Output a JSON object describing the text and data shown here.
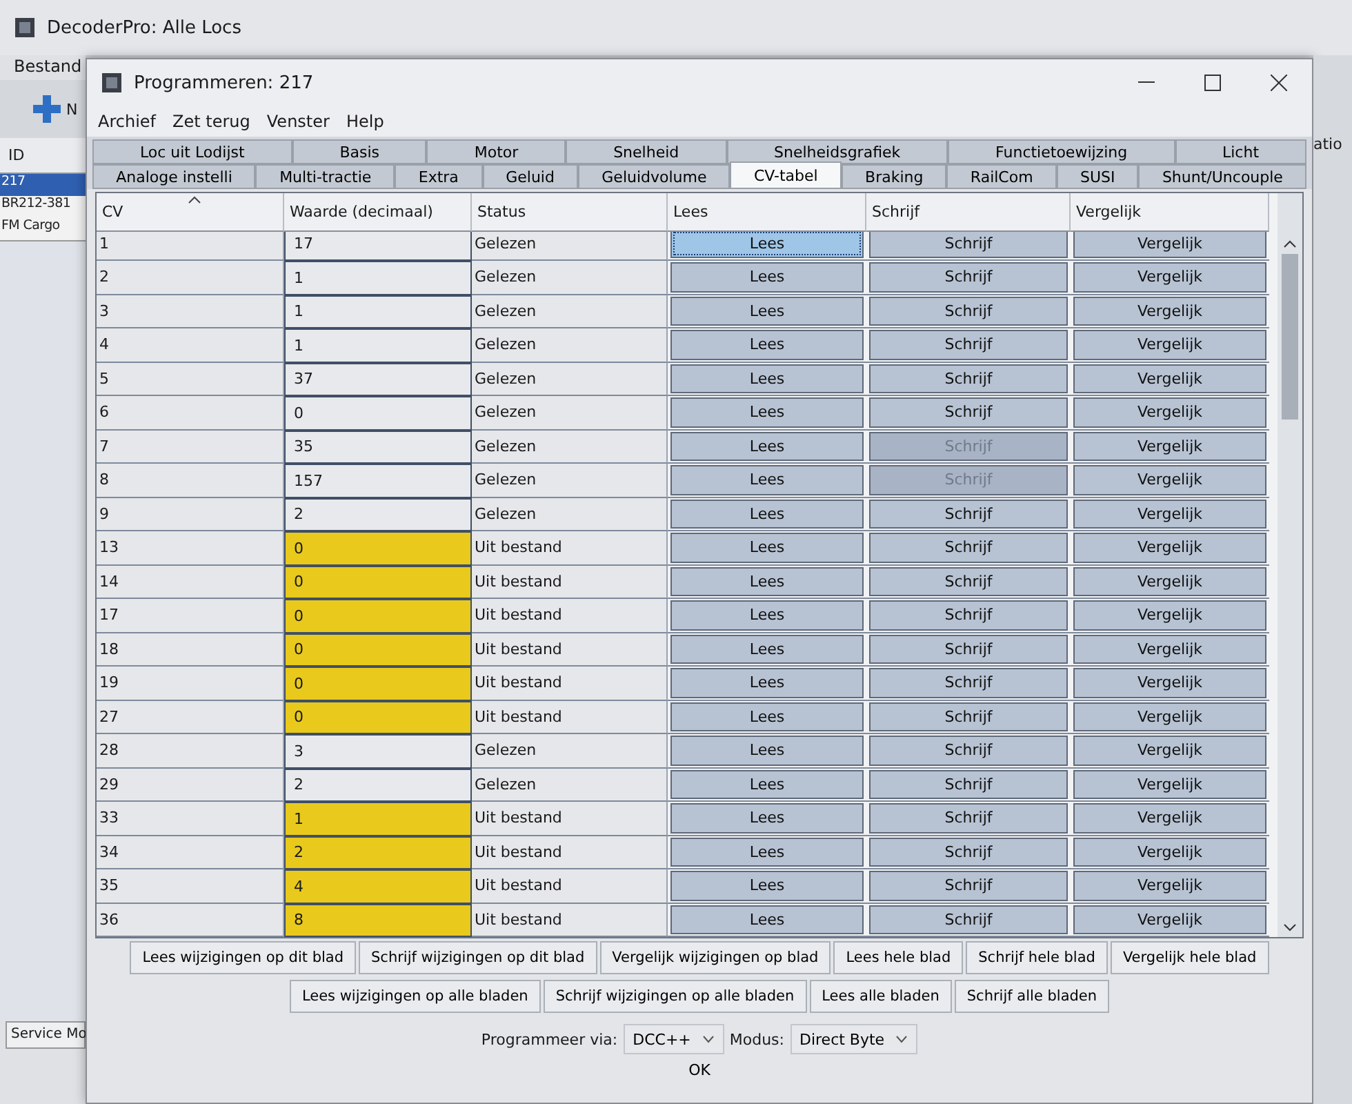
{
  "main_window": {
    "title": "DecoderPro: Alle Locs",
    "menu": [
      "Bestand"
    ],
    "toolbar_label": "N",
    "list_header": "ID",
    "locs": [
      {
        "label": "217",
        "selected": true
      },
      {
        "label": "BR212-381",
        "selected": false
      },
      {
        "label": "FM Cargo",
        "selected": false
      }
    ],
    "status_tab": "Service Mo",
    "right_edge_text": "atio"
  },
  "dialog": {
    "title": "Programmeren: 217",
    "menu": [
      "Archief",
      "Zet terug",
      "Venster",
      "Help"
    ],
    "tab_rows": [
      [
        {
          "label": "Loc uit Lodijst",
          "selected": false
        },
        {
          "label": "Basis",
          "selected": false
        },
        {
          "label": "Motor",
          "selected": false
        },
        {
          "label": "Snelheid",
          "selected": false
        },
        {
          "label": "Snelheidsgrafiek",
          "selected": false
        },
        {
          "label": "Functietoewijzing",
          "selected": false
        },
        {
          "label": "Licht",
          "selected": false
        }
      ],
      [
        {
          "label": "Analoge instelli",
          "selected": false
        },
        {
          "label": "Multi-tractie",
          "selected": false
        },
        {
          "label": "Extra",
          "selected": false
        },
        {
          "label": "Geluid",
          "selected": false
        },
        {
          "label": "Geluidvolume",
          "selected": false
        },
        {
          "label": "CV-tabel",
          "selected": true
        },
        {
          "label": "Braking",
          "selected": false
        },
        {
          "label": "RailCom",
          "selected": false
        },
        {
          "label": "SUSI",
          "selected": false
        },
        {
          "label": "Shunt/Uncouple",
          "selected": false
        }
      ]
    ],
    "table": {
      "columns": [
        "CV",
        "Waarde (decimaal)",
        "Status",
        "Lees",
        "Schrijf",
        "Vergelijk"
      ],
      "rows": [
        {
          "cv": "1",
          "value": "17",
          "status": "Gelezen",
          "from_file": false,
          "read": "Lees",
          "read_focused": true,
          "write": "Schrijf",
          "write_disabled": false,
          "compare": "Vergelijk"
        },
        {
          "cv": "2",
          "value": "1",
          "status": "Gelezen",
          "from_file": false,
          "read": "Lees",
          "read_focused": false,
          "write": "Schrijf",
          "write_disabled": false,
          "compare": "Vergelijk"
        },
        {
          "cv": "3",
          "value": "1",
          "status": "Gelezen",
          "from_file": false,
          "read": "Lees",
          "read_focused": false,
          "write": "Schrijf",
          "write_disabled": false,
          "compare": "Vergelijk"
        },
        {
          "cv": "4",
          "value": "1",
          "status": "Gelezen",
          "from_file": false,
          "read": "Lees",
          "read_focused": false,
          "write": "Schrijf",
          "write_disabled": false,
          "compare": "Vergelijk"
        },
        {
          "cv": "5",
          "value": "37",
          "status": "Gelezen",
          "from_file": false,
          "read": "Lees",
          "read_focused": false,
          "write": "Schrijf",
          "write_disabled": false,
          "compare": "Vergelijk"
        },
        {
          "cv": "6",
          "value": "0",
          "status": "Gelezen",
          "from_file": false,
          "read": "Lees",
          "read_focused": false,
          "write": "Schrijf",
          "write_disabled": false,
          "compare": "Vergelijk"
        },
        {
          "cv": "7",
          "value": "35",
          "status": "Gelezen",
          "from_file": false,
          "read": "Lees",
          "read_focused": false,
          "write": "Schrijf",
          "write_disabled": true,
          "compare": "Vergelijk"
        },
        {
          "cv": "8",
          "value": "157",
          "status": "Gelezen",
          "from_file": false,
          "read": "Lees",
          "read_focused": false,
          "write": "Schrijf",
          "write_disabled": true,
          "compare": "Vergelijk"
        },
        {
          "cv": "9",
          "value": "2",
          "status": "Gelezen",
          "from_file": false,
          "read": "Lees",
          "read_focused": false,
          "write": "Schrijf",
          "write_disabled": false,
          "compare": "Vergelijk"
        },
        {
          "cv": "13",
          "value": "0",
          "status": "Uit bestand",
          "from_file": true,
          "read": "Lees",
          "read_focused": false,
          "write": "Schrijf",
          "write_disabled": false,
          "compare": "Vergelijk"
        },
        {
          "cv": "14",
          "value": "0",
          "status": "Uit bestand",
          "from_file": true,
          "read": "Lees",
          "read_focused": false,
          "write": "Schrijf",
          "write_disabled": false,
          "compare": "Vergelijk"
        },
        {
          "cv": "17",
          "value": "0",
          "status": "Uit bestand",
          "from_file": true,
          "read": "Lees",
          "read_focused": false,
          "write": "Schrijf",
          "write_disabled": false,
          "compare": "Vergelijk"
        },
        {
          "cv": "18",
          "value": "0",
          "status": "Uit bestand",
          "from_file": true,
          "read": "Lees",
          "read_focused": false,
          "write": "Schrijf",
          "write_disabled": false,
          "compare": "Vergelijk"
        },
        {
          "cv": "19",
          "value": "0",
          "status": "Uit bestand",
          "from_file": true,
          "read": "Lees",
          "read_focused": false,
          "write": "Schrijf",
          "write_disabled": false,
          "compare": "Vergelijk"
        },
        {
          "cv": "27",
          "value": "0",
          "status": "Uit bestand",
          "from_file": true,
          "read": "Lees",
          "read_focused": false,
          "write": "Schrijf",
          "write_disabled": false,
          "compare": "Vergelijk"
        },
        {
          "cv": "28",
          "value": "3",
          "status": "Gelezen",
          "from_file": false,
          "read": "Lees",
          "read_focused": false,
          "write": "Schrijf",
          "write_disabled": false,
          "compare": "Vergelijk"
        },
        {
          "cv": "29",
          "value": "2",
          "status": "Gelezen",
          "from_file": false,
          "read": "Lees",
          "read_focused": false,
          "write": "Schrijf",
          "write_disabled": false,
          "compare": "Vergelijk"
        },
        {
          "cv": "33",
          "value": "1",
          "status": "Uit bestand",
          "from_file": true,
          "read": "Lees",
          "read_focused": false,
          "write": "Schrijf",
          "write_disabled": false,
          "compare": "Vergelijk"
        },
        {
          "cv": "34",
          "value": "2",
          "status": "Uit bestand",
          "from_file": true,
          "read": "Lees",
          "read_focused": false,
          "write": "Schrijf",
          "write_disabled": false,
          "compare": "Vergelijk"
        },
        {
          "cv": "35",
          "value": "4",
          "status": "Uit bestand",
          "from_file": true,
          "read": "Lees",
          "read_focused": false,
          "write": "Schrijf",
          "write_disabled": false,
          "compare": "Vergelijk"
        },
        {
          "cv": "36",
          "value": "8",
          "status": "Uit bestand",
          "from_file": true,
          "read": "Lees",
          "read_focused": false,
          "write": "Schrijf",
          "write_disabled": false,
          "compare": "Vergelijk"
        }
      ]
    },
    "action_rows": [
      [
        "Lees wijzigingen op dit blad",
        "Schrijf wijzigingen op dit blad",
        "Vergelijk wijzigingen op blad",
        "Lees hele blad",
        "Schrijf hele blad",
        "Vergelijk hele blad"
      ],
      [
        "Lees wijzigingen op alle bladen",
        "Schrijf wijzigingen op alle bladen",
        "Lees alle bladen",
        "Schrijf alle bladen"
      ]
    ],
    "programmer": {
      "via_label": "Programmeer via:",
      "via_value": "DCC++",
      "mode_label": "Modus:",
      "mode_value": "Direct Byte"
    },
    "ok_button": "OK"
  }
}
